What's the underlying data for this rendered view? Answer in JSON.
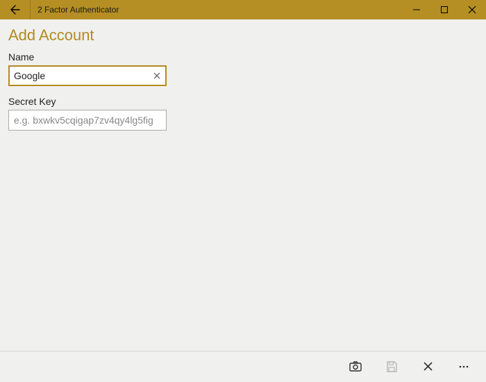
{
  "window": {
    "title": "2 Factor Authenticator"
  },
  "page": {
    "title": "Add Account"
  },
  "form": {
    "name_label": "Name",
    "name_value": "Google",
    "secret_label": "Secret Key",
    "secret_value": "",
    "secret_placeholder": "e.g. bxwkv5cqigap7zv4qy4lg5fig"
  },
  "icons": {
    "back": "back-arrow",
    "minimize": "minimize",
    "maximize": "maximize",
    "close": "close",
    "camera": "camera",
    "save": "save",
    "cancel": "cancel-x",
    "more": "more-dots"
  },
  "colors": {
    "accent": "#b28a1e",
    "titlebar": "#b58f23",
    "background": "#f0f0ef"
  }
}
